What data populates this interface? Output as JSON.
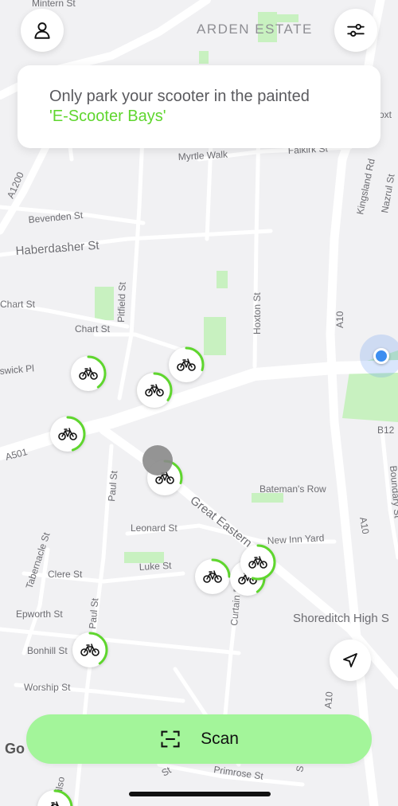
{
  "notice": {
    "line1": "Only park your scooter in the painted",
    "line2": "'E-Scooter Bays'"
  },
  "map": {
    "area_label": "ARDEN ESTATE",
    "streets": {
      "mintern": "Mintern St",
      "myrtle": "Myrtle Walk",
      "falkirk": "Falkirk St",
      "kingsland": "Kingsland Rd",
      "nazrul": "Nazrul St",
      "a1200": "A1200",
      "bevenden": "Bevenden St",
      "haberdasher": "Haberdasher St",
      "pitfield": "Pitfield St",
      "hoxton": "Hoxton St",
      "a10_top": "A10",
      "chart1": "Chart St",
      "chart2": "Chart St",
      "swick": "swick Pl",
      "b12": "B12",
      "a501": "A501",
      "paul1": "Paul St",
      "great_eastern": "Great Eastern",
      "batemans": "Bateman's Row",
      "boundary": "Boundary St",
      "a10_mid": "A10",
      "leonard": "Leonard St",
      "new_inn": "New Inn Yard",
      "tabernacle": "Tabernacle St",
      "clere": "Clere St",
      "luke": "Luke St",
      "curtain": "Curtain Rd",
      "shoreditch": "Shoreditch High S",
      "epworth": "Epworth St",
      "paul2": "Paul St",
      "bonhill": "Bonhill St",
      "worship": "Worship St",
      "a10_bottom": "A10",
      "primrose": "Primrose St",
      "wilson": "Wilso",
      "oxt": "oxt",
      "st": "St",
      "p": "S"
    }
  },
  "vehicles": [
    {
      "battery_pct": 40
    },
    {
      "battery_pct": 35
    },
    {
      "battery_pct": 30
    },
    {
      "battery_pct": 45
    },
    {
      "battery_pct": 30
    },
    {
      "battery_pct": 25
    },
    {
      "battery_pct": 40
    },
    {
      "battery_pct": 55
    },
    {
      "battery_pct": 40
    },
    {
      "battery_pct": 30
    }
  ],
  "scan": {
    "label": "Scan"
  },
  "attribution": "Go",
  "icons": {
    "profile": "user-icon",
    "filter": "sliders-icon",
    "locate": "navigation-arrow-icon",
    "scan": "scan-frame-icon",
    "vehicle": "bicycle-icon"
  },
  "colors": {
    "accent": "#5fd62e",
    "scan_button": "#a3f59a",
    "user_location": "#3d8ef0",
    "park_green": "#c8f1c0"
  }
}
